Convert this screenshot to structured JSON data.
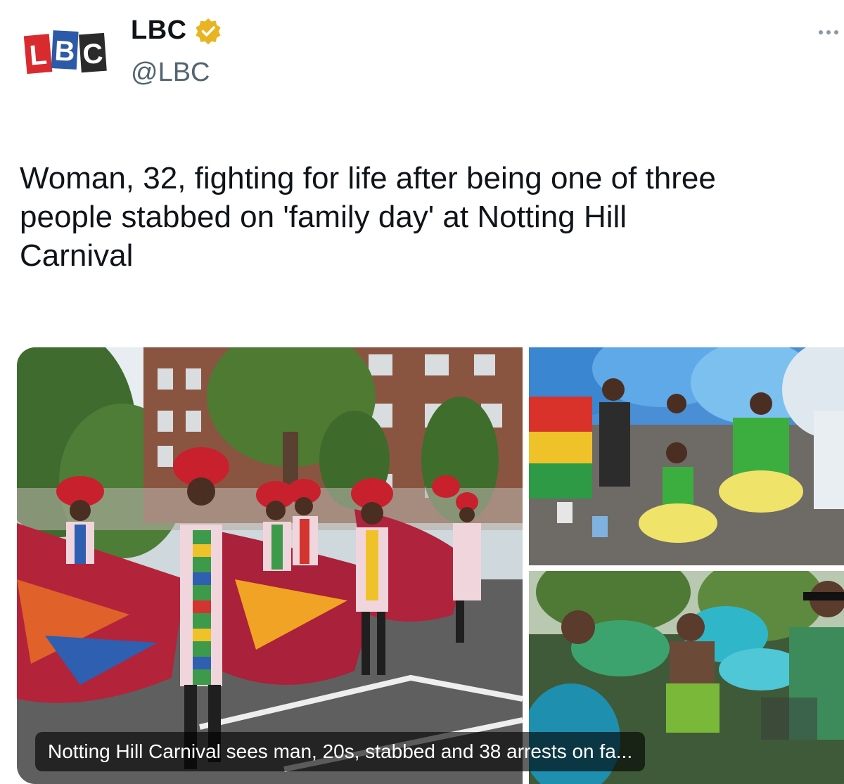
{
  "header": {
    "display_name": "LBC",
    "handle": "@LBC",
    "logo_letters": "LBC",
    "verified_icon": "verified-badge-icon",
    "more_icon": "more-dots-icon"
  },
  "tweet": {
    "text": "Woman, 32, fighting for life after being one of three\npeople stabbed on 'family day' at Notting Hill\nCarnival"
  },
  "media": {
    "images": [
      "carnival-parade-photo",
      "carnival-dancers-photo",
      "carnival-street-photo"
    ],
    "caption": "Notting Hill Carnival sees man, 20s, stabbed and 38 arrests on fa..."
  },
  "colors": {
    "logo_red": "#d92b2f",
    "logo_blue": "#2d5aa8",
    "logo_dark": "#2b2b2b",
    "verified_gold": "#e8b422",
    "text_primary": "#0f1419",
    "text_secondary": "#536471"
  }
}
